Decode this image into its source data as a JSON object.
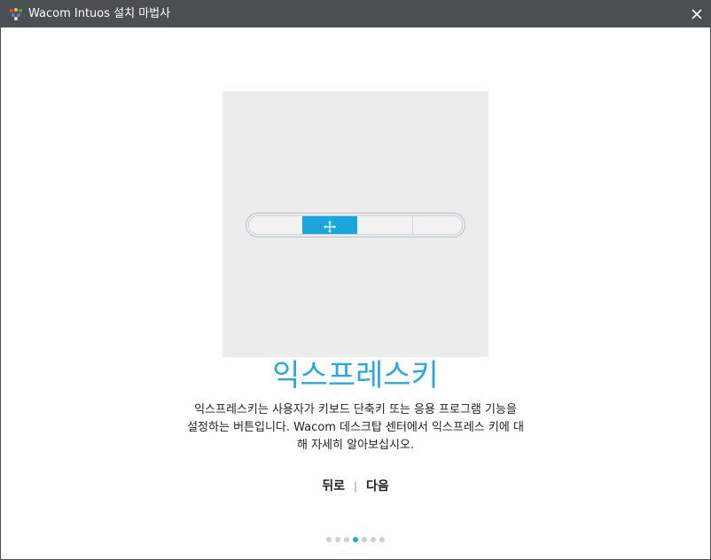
{
  "window": {
    "title": "Wacom Intuos 설치 마법사",
    "icon": "wacom-app-icon",
    "close_icon": "close-icon"
  },
  "illustration": {
    "highlight_color": "#1ba6dd",
    "highlighted_key_icon": "move-arrows-icon",
    "key_count": 4,
    "highlighted_index": 2
  },
  "content": {
    "heading": "익스프레스키",
    "description_lines": [
      "익스프레스키는 사용자가 키보드 단축키 또는 응용 프로그램 기능을",
      "설정하는 버튼입니다. Wacom 데스크탑 센터에서 익스프레스 키에 대",
      "해 자세히 알아보십시오."
    ]
  },
  "nav": {
    "back_label": "뒤로",
    "separator": "|",
    "next_label": "다음"
  },
  "pagination": {
    "total": 7,
    "current": 4
  },
  "colors": {
    "titlebar": "#4a4f54",
    "accent": "#2aa9df",
    "illustration_bg": "#ececec"
  }
}
